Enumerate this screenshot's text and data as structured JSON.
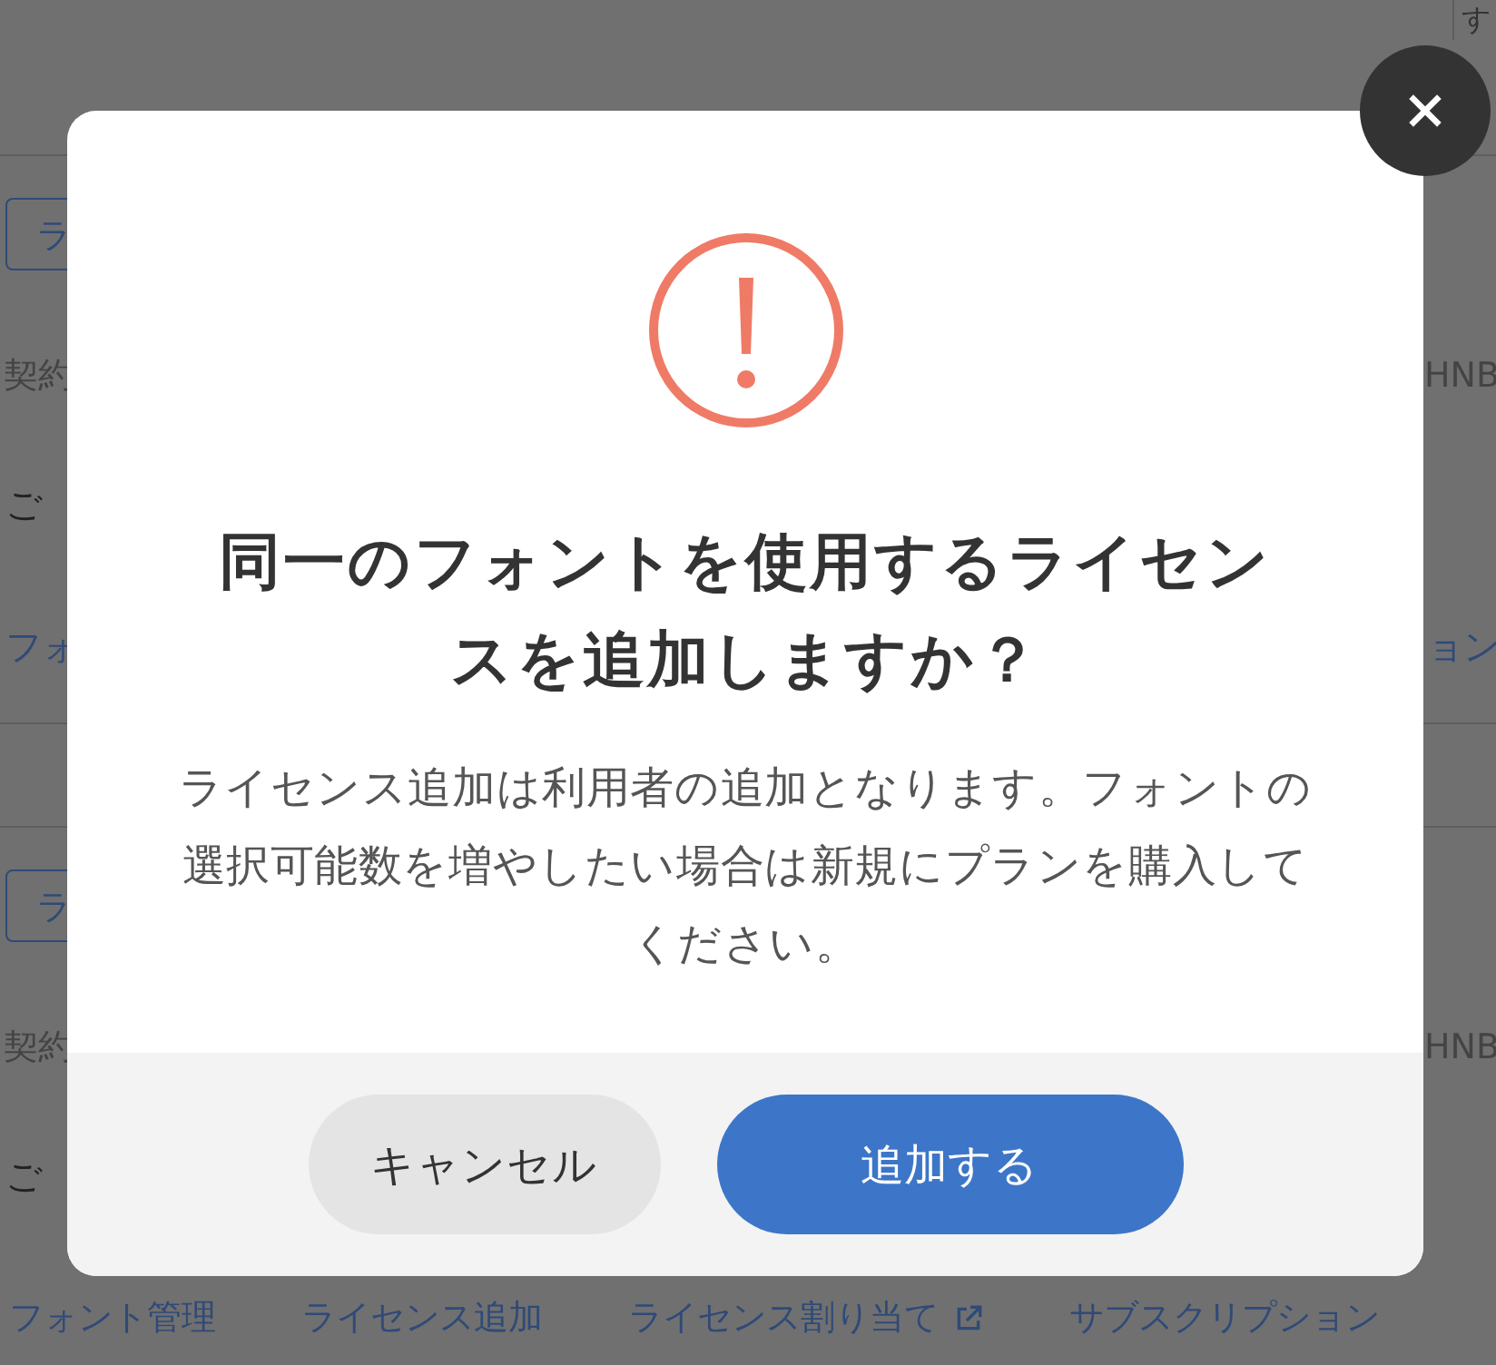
{
  "background": {
    "rows": [
      {
        "kind": "header",
        "right": "す"
      },
      {
        "kind": "button",
        "left": "ラ"
      },
      {
        "kind": "meta",
        "left": "契約",
        "right": "HNB"
      },
      {
        "kind": "text",
        "left": "ご"
      },
      {
        "kind": "link",
        "left": "フォ",
        "right": "ョン"
      },
      {
        "kind": "gap"
      },
      {
        "kind": "button",
        "left": "ラ"
      },
      {
        "kind": "meta",
        "left": "契約",
        "right": "HNB"
      },
      {
        "kind": "text",
        "left": "ご"
      }
    ],
    "links": [
      {
        "text": "フォント管理",
        "external": false
      },
      {
        "text": "ライセンス追加",
        "external": false
      },
      {
        "text": "ライセンス割り当て",
        "external": true
      },
      {
        "text": "サブスクリプション",
        "external": false
      }
    ]
  },
  "dialog": {
    "title": "同一のフォントを使用するライセンスを追加しますか？",
    "message": "ライセンス追加は利用者の追加となります。フォントの選択可能数を増やしたい場合は新規にプランを購入してください。",
    "buttons": [
      {
        "text": "キャンセル",
        "kind": "secondary"
      },
      {
        "text": "追加する",
        "kind": "primary"
      }
    ]
  }
}
